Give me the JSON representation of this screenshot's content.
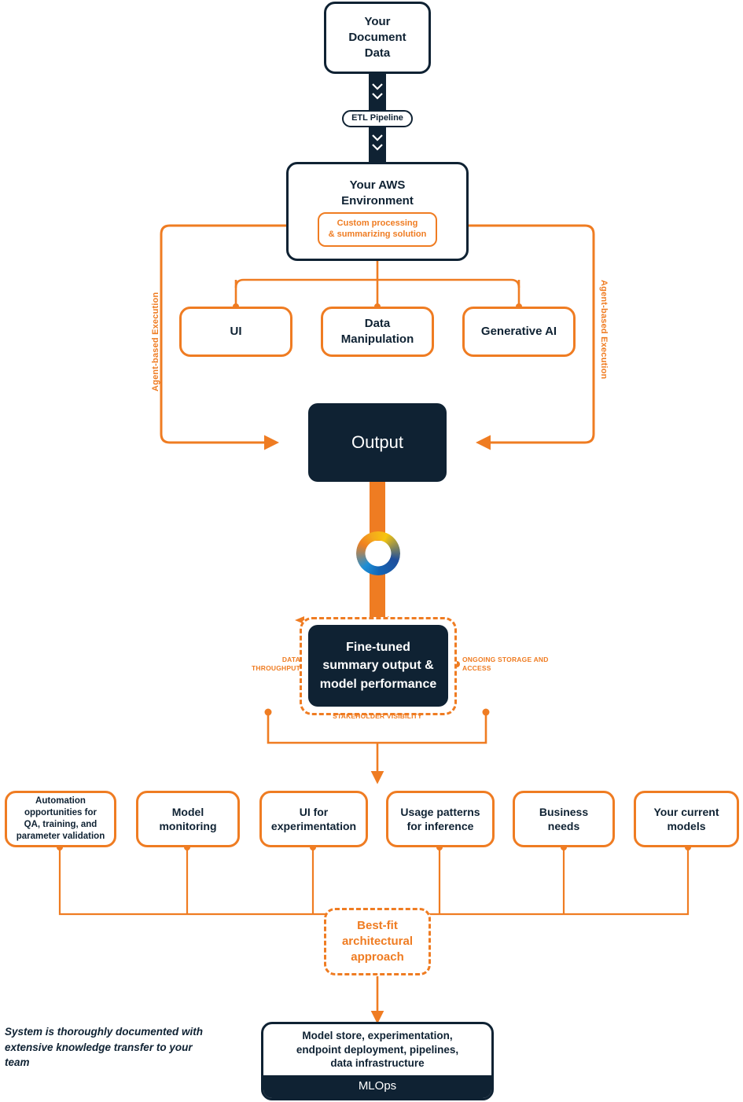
{
  "diagram": {
    "title_nodes": {
      "document_data": "Your\nDocument\nData",
      "etl_pipeline": "ETL Pipeline",
      "aws_env": "Your AWS\nEnvironment",
      "custom_processing": "Custom processing\n& summarizing solution",
      "ui": "UI",
      "data_manipulation": "Data\nManipulation",
      "generative_ai": "Generative AI",
      "output": "Output",
      "fine_tuned": "Fine-tuned\nsummary output &\nmodel performance",
      "best_fit": "Best-fit\narchitectural\napproach",
      "mlops_desc": "Model store, experimentation,\nendpoint deployment, pipelines,\ndata infrastructure",
      "mlops_bar": "MLOps"
    },
    "side_labels": {
      "left": "Agent-based Execution",
      "right": "Agent-based Execution"
    },
    "flow_captions": {
      "data_throughput": "DATA\nTHROUGHPUT",
      "ongoing_storage": "ONGOING STORAGE\nAND ACCESS",
      "stakeholder_visibility": "STAKEHOLDER\nVISIBILITY"
    },
    "consideration_boxes": [
      "Automation\nopportunities for\nQA, training, and\nparameter validation",
      "Model\nmonitoring",
      "UI for\nexperimentation",
      "Usage patterns\nfor inference",
      "Business\nneeds",
      "Your current\nmodels"
    ],
    "footnote": "System is thoroughly documented\nwith extensive knowledge\ntransfer to your team",
    "colors": {
      "navy": "#0f2233",
      "orange": "#ef7c22",
      "white": "#ffffff",
      "ring_orange": "#f08020",
      "ring_yellow": "#f6c60e",
      "ring_blue_dark": "#1f4f9c",
      "ring_blue_light": "#1e8fd5"
    },
    "icons": {
      "ring_logo": "brand-ring-icon",
      "arrow_down": "arrow-down-icon",
      "arrow_right": "arrow-right-icon",
      "arrow_left": "arrow-left-icon",
      "arrow_up": "arrow-up-icon"
    }
  }
}
